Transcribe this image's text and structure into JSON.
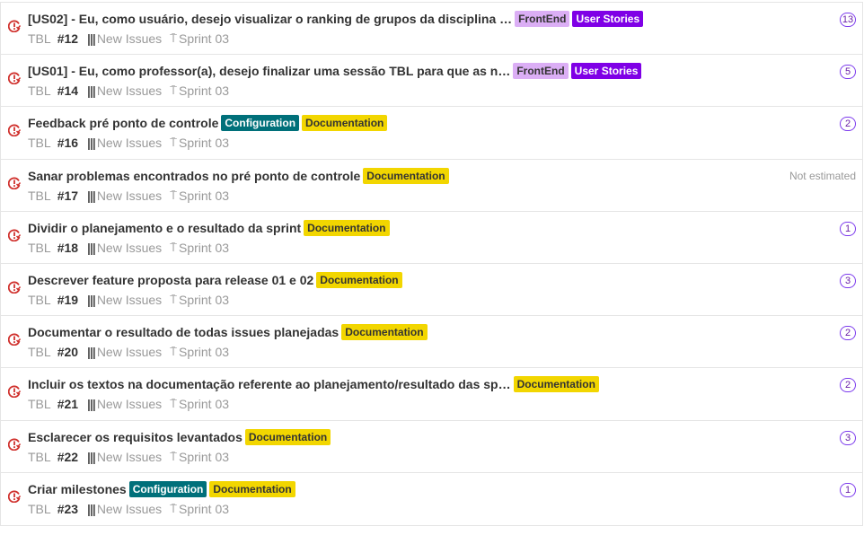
{
  "label_colors": {
    "FrontEnd": {
      "bg": "#dbaef5",
      "fg": "#333333"
    },
    "User Stories": {
      "bg": "#7f00e6",
      "fg": "#ffffff"
    },
    "Configuration": {
      "bg": "#00707a",
      "fg": "#ffffff"
    },
    "Documentation": {
      "bg": "#f2d600",
      "fg": "#333333"
    }
  },
  "status_icon": "issue-alert-clock-icon",
  "issues": [
    {
      "title": "[US02] - Eu, como usuário, desejo visualizar o ranking de grupos da disciplina …",
      "labels": [
        "FrontEnd",
        "User Stories"
      ],
      "project": "TBL",
      "number": "#12",
      "pipeline": "New Issues",
      "milestone": "Sprint 03",
      "estimate": "13"
    },
    {
      "title": "[US01] - Eu, como professor(a), desejo finalizar uma sessão TBL para que as n…",
      "labels": [
        "FrontEnd",
        "User Stories"
      ],
      "project": "TBL",
      "number": "#14",
      "pipeline": "New Issues",
      "milestone": "Sprint 03",
      "estimate": "5"
    },
    {
      "title": "Feedback pré ponto de controle",
      "labels": [
        "Configuration",
        "Documentation"
      ],
      "project": "TBL",
      "number": "#16",
      "pipeline": "New Issues",
      "milestone": "Sprint 03",
      "estimate": "2"
    },
    {
      "title": "Sanar problemas encontrados no pré ponto de controle",
      "labels": [
        "Documentation"
      ],
      "project": "TBL",
      "number": "#17",
      "pipeline": "New Issues",
      "milestone": "Sprint 03",
      "estimate": "Not estimated"
    },
    {
      "title": "Dividir o planejamento e o resultado da sprint",
      "labels": [
        "Documentation"
      ],
      "project": "TBL",
      "number": "#18",
      "pipeline": "New Issues",
      "milestone": "Sprint 03",
      "estimate": "1"
    },
    {
      "title": "Descrever feature proposta para release 01 e 02",
      "labels": [
        "Documentation"
      ],
      "project": "TBL",
      "number": "#19",
      "pipeline": "New Issues",
      "milestone": "Sprint 03",
      "estimate": "3"
    },
    {
      "title": "Documentar o resultado de todas issues planejadas",
      "labels": [
        "Documentation"
      ],
      "project": "TBL",
      "number": "#20",
      "pipeline": "New Issues",
      "milestone": "Sprint 03",
      "estimate": "2"
    },
    {
      "title": "Incluir os textos na documentação referente ao planejamento/resultado das sp…",
      "labels": [
        "Documentation"
      ],
      "project": "TBL",
      "number": "#21",
      "pipeline": "New Issues",
      "milestone": "Sprint 03",
      "estimate": "2"
    },
    {
      "title": "Esclarecer os requisitos levantados",
      "labels": [
        "Documentation"
      ],
      "project": "TBL",
      "number": "#22",
      "pipeline": "New Issues",
      "milestone": "Sprint 03",
      "estimate": "3"
    },
    {
      "title": "Criar milestones",
      "labels": [
        "Configuration",
        "Documentation"
      ],
      "project": "TBL",
      "number": "#23",
      "pipeline": "New Issues",
      "milestone": "Sprint 03",
      "estimate": "1"
    }
  ]
}
